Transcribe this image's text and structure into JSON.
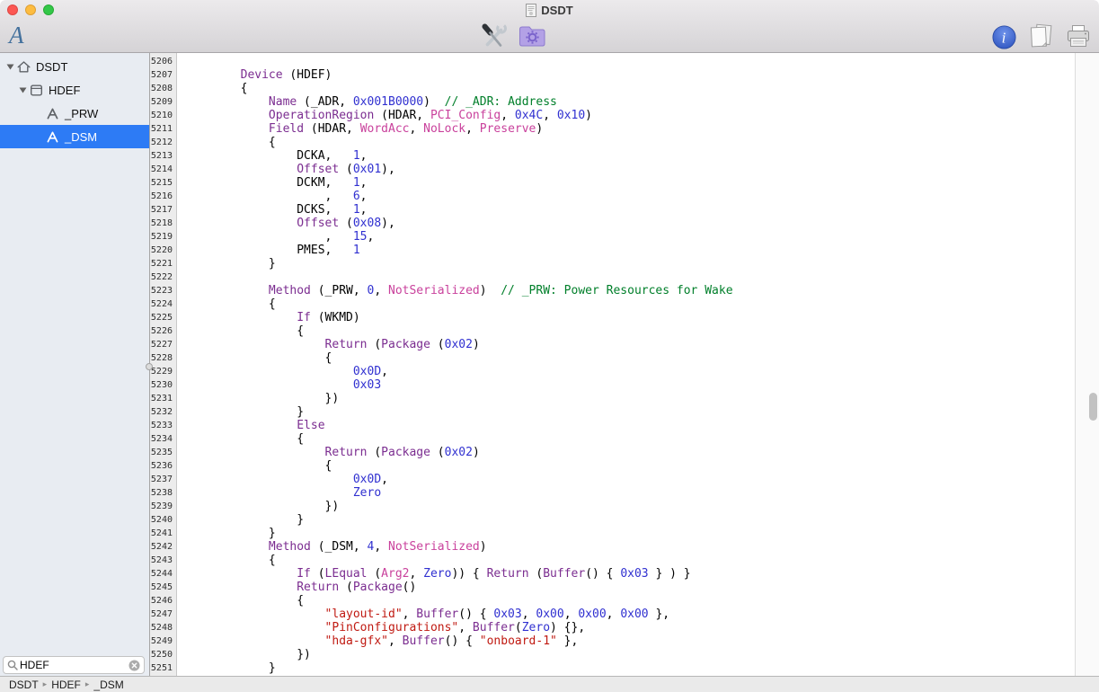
{
  "window": {
    "title": "DSDT"
  },
  "toolbar": {
    "font_button_label": "A",
    "center_items": [
      {
        "name": "compile-tools",
        "icon": "screwdriver-wrench-icon"
      },
      {
        "name": "patch",
        "icon": "folder-gear-icon"
      }
    ],
    "right_items": [
      {
        "name": "info",
        "icon": "info-icon"
      },
      {
        "name": "summary",
        "icon": "documents-icon"
      },
      {
        "name": "print",
        "icon": "printer-icon"
      }
    ]
  },
  "sidebar": {
    "items": [
      {
        "label": "DSDT",
        "icon": "house-icon",
        "level": 0,
        "expanded": true,
        "selected": false
      },
      {
        "label": "HDEF",
        "icon": "device-icon",
        "level": 1,
        "expanded": true,
        "selected": false
      },
      {
        "label": "_PRW",
        "icon": "method-icon",
        "level": 2,
        "expanded": false,
        "selected": false
      },
      {
        "label": "_DSM",
        "icon": "method-icon",
        "level": 2,
        "expanded": false,
        "selected": true
      }
    ],
    "search": {
      "value": "HDEF"
    }
  },
  "statusbar": {
    "path": [
      "DSDT",
      "HDEF",
      "_DSM"
    ],
    "separator": "▸"
  },
  "colors": {
    "selection": "#2d7bf5"
  },
  "editor": {
    "first_line": 5206,
    "last_line": 5251,
    "syntax_colors": {
      "keyword": "#7b2d90",
      "number": "#3030d0",
      "string": "#c01a12",
      "comment": "#007f2a",
      "predefined": "#c9419c",
      "plain": "#000000"
    },
    "lines": [
      {
        "n": 5206,
        "s": []
      },
      {
        "n": 5207,
        "s": [
          [
            "t",
            "        "
          ],
          [
            "k",
            "Device"
          ],
          [
            "t",
            " (HDEF)"
          ]
        ]
      },
      {
        "n": 5208,
        "s": [
          [
            "t",
            "        {"
          ]
        ]
      },
      {
        "n": 5209,
        "s": [
          [
            "t",
            "            "
          ],
          [
            "k",
            "Name"
          ],
          [
            "t",
            " (_ADR, "
          ],
          [
            "n",
            "0x001B0000"
          ],
          [
            "t",
            ")  "
          ],
          [
            "c",
            "// _ADR: Address"
          ]
        ]
      },
      {
        "n": 5210,
        "s": [
          [
            "t",
            "            "
          ],
          [
            "k",
            "OperationRegion"
          ],
          [
            "t",
            " (HDAR, "
          ],
          [
            "p",
            "PCI_Config"
          ],
          [
            "t",
            ", "
          ],
          [
            "n",
            "0x4C"
          ],
          [
            "t",
            ", "
          ],
          [
            "n",
            "0x10"
          ],
          [
            "t",
            ")"
          ]
        ]
      },
      {
        "n": 5211,
        "s": [
          [
            "t",
            "            "
          ],
          [
            "k",
            "Field"
          ],
          [
            "t",
            " (HDAR, "
          ],
          [
            "p",
            "WordAcc"
          ],
          [
            "t",
            ", "
          ],
          [
            "p",
            "NoLock"
          ],
          [
            "t",
            ", "
          ],
          [
            "p",
            "Preserve"
          ],
          [
            "t",
            ")"
          ]
        ]
      },
      {
        "n": 5212,
        "s": [
          [
            "t",
            "            {"
          ]
        ]
      },
      {
        "n": 5213,
        "s": [
          [
            "t",
            "                DCKA,   "
          ],
          [
            "n",
            "1"
          ],
          [
            "t",
            ","
          ]
        ]
      },
      {
        "n": 5214,
        "s": [
          [
            "t",
            "                "
          ],
          [
            "k",
            "Offset"
          ],
          [
            "t",
            " ("
          ],
          [
            "n",
            "0x01"
          ],
          [
            "t",
            "),"
          ]
        ]
      },
      {
        "n": 5215,
        "s": [
          [
            "t",
            "                DCKM,   "
          ],
          [
            "n",
            "1"
          ],
          [
            "t",
            ","
          ]
        ]
      },
      {
        "n": 5216,
        "s": [
          [
            "t",
            "                    ,   "
          ],
          [
            "n",
            "6"
          ],
          [
            "t",
            ","
          ]
        ]
      },
      {
        "n": 5217,
        "s": [
          [
            "t",
            "                DCKS,   "
          ],
          [
            "n",
            "1"
          ],
          [
            "t",
            ","
          ]
        ]
      },
      {
        "n": 5218,
        "s": [
          [
            "t",
            "                "
          ],
          [
            "k",
            "Offset"
          ],
          [
            "t",
            " ("
          ],
          [
            "n",
            "0x08"
          ],
          [
            "t",
            "),"
          ]
        ]
      },
      {
        "n": 5219,
        "s": [
          [
            "t",
            "                    ,   "
          ],
          [
            "n",
            "15"
          ],
          [
            "t",
            ","
          ]
        ]
      },
      {
        "n": 5220,
        "s": [
          [
            "t",
            "                PMES,   "
          ],
          [
            "n",
            "1"
          ]
        ]
      },
      {
        "n": 5221,
        "s": [
          [
            "t",
            "            }"
          ]
        ]
      },
      {
        "n": 5222,
        "s": []
      },
      {
        "n": 5223,
        "s": [
          [
            "t",
            "            "
          ],
          [
            "k",
            "Method"
          ],
          [
            "t",
            " (_PRW, "
          ],
          [
            "n",
            "0"
          ],
          [
            "t",
            ", "
          ],
          [
            "p",
            "NotSerialized"
          ],
          [
            "t",
            ")  "
          ],
          [
            "c",
            "// _PRW: Power Resources for Wake"
          ]
        ]
      },
      {
        "n": 5224,
        "s": [
          [
            "t",
            "            {"
          ]
        ]
      },
      {
        "n": 5225,
        "s": [
          [
            "t",
            "                "
          ],
          [
            "k",
            "If"
          ],
          [
            "t",
            " (WKMD)"
          ]
        ]
      },
      {
        "n": 5226,
        "s": [
          [
            "t",
            "                {"
          ]
        ]
      },
      {
        "n": 5227,
        "s": [
          [
            "t",
            "                    "
          ],
          [
            "k",
            "Return"
          ],
          [
            "t",
            " ("
          ],
          [
            "k",
            "Package"
          ],
          [
            "t",
            " ("
          ],
          [
            "n",
            "0x02"
          ],
          [
            "t",
            ")"
          ]
        ]
      },
      {
        "n": 5228,
        "s": [
          [
            "t",
            "                    {"
          ]
        ]
      },
      {
        "n": 5229,
        "s": [
          [
            "t",
            "                        "
          ],
          [
            "n",
            "0x0D"
          ],
          [
            "t",
            ","
          ]
        ]
      },
      {
        "n": 5230,
        "s": [
          [
            "t",
            "                        "
          ],
          [
            "n",
            "0x03"
          ]
        ]
      },
      {
        "n": 5231,
        "s": [
          [
            "t",
            "                    })"
          ]
        ]
      },
      {
        "n": 5232,
        "s": [
          [
            "t",
            "                }"
          ]
        ]
      },
      {
        "n": 5233,
        "s": [
          [
            "t",
            "                "
          ],
          [
            "k",
            "Else"
          ]
        ]
      },
      {
        "n": 5234,
        "s": [
          [
            "t",
            "                {"
          ]
        ]
      },
      {
        "n": 5235,
        "s": [
          [
            "t",
            "                    "
          ],
          [
            "k",
            "Return"
          ],
          [
            "t",
            " ("
          ],
          [
            "k",
            "Package"
          ],
          [
            "t",
            " ("
          ],
          [
            "n",
            "0x02"
          ],
          [
            "t",
            ")"
          ]
        ]
      },
      {
        "n": 5236,
        "s": [
          [
            "t",
            "                    {"
          ]
        ]
      },
      {
        "n": 5237,
        "s": [
          [
            "t",
            "                        "
          ],
          [
            "n",
            "0x0D"
          ],
          [
            "t",
            ","
          ]
        ]
      },
      {
        "n": 5238,
        "s": [
          [
            "t",
            "                        "
          ],
          [
            "n",
            "Zero"
          ]
        ]
      },
      {
        "n": 5239,
        "s": [
          [
            "t",
            "                    })"
          ]
        ]
      },
      {
        "n": 5240,
        "s": [
          [
            "t",
            "                }"
          ]
        ]
      },
      {
        "n": 5241,
        "s": [
          [
            "t",
            "            }"
          ]
        ]
      },
      {
        "n": 5242,
        "s": [
          [
            "t",
            "            "
          ],
          [
            "k",
            "Method"
          ],
          [
            "t",
            " (_DSM, "
          ],
          [
            "n",
            "4"
          ],
          [
            "t",
            ", "
          ],
          [
            "p",
            "NotSerialized"
          ],
          [
            "t",
            ")"
          ]
        ]
      },
      {
        "n": 5243,
        "s": [
          [
            "t",
            "            {"
          ]
        ]
      },
      {
        "n": 5244,
        "s": [
          [
            "t",
            "                "
          ],
          [
            "k",
            "If"
          ],
          [
            "t",
            " ("
          ],
          [
            "k",
            "LEqual"
          ],
          [
            "t",
            " ("
          ],
          [
            "p",
            "Arg2"
          ],
          [
            "t",
            ", "
          ],
          [
            "n",
            "Zero"
          ],
          [
            "t",
            ")) { "
          ],
          [
            "k",
            "Return"
          ],
          [
            "t",
            " ("
          ],
          [
            "k",
            "Buffer"
          ],
          [
            "t",
            "() { "
          ],
          [
            "n",
            "0x03"
          ],
          [
            "t",
            " } ) }"
          ]
        ]
      },
      {
        "n": 5245,
        "s": [
          [
            "t",
            "                "
          ],
          [
            "k",
            "Return"
          ],
          [
            "t",
            " ("
          ],
          [
            "k",
            "Package"
          ],
          [
            "t",
            "()"
          ]
        ]
      },
      {
        "n": 5246,
        "s": [
          [
            "t",
            "                {"
          ]
        ]
      },
      {
        "n": 5247,
        "s": [
          [
            "t",
            "                    "
          ],
          [
            "s",
            "\"layout-id\""
          ],
          [
            "t",
            ", "
          ],
          [
            "k",
            "Buffer"
          ],
          [
            "t",
            "() { "
          ],
          [
            "n",
            "0x03"
          ],
          [
            "t",
            ", "
          ],
          [
            "n",
            "0x00"
          ],
          [
            "t",
            ", "
          ],
          [
            "n",
            "0x00"
          ],
          [
            "t",
            ", "
          ],
          [
            "n",
            "0x00"
          ],
          [
            "t",
            " },"
          ]
        ]
      },
      {
        "n": 5248,
        "s": [
          [
            "t",
            "                    "
          ],
          [
            "s",
            "\"PinConfigurations\""
          ],
          [
            "t",
            ", "
          ],
          [
            "k",
            "Buffer"
          ],
          [
            "t",
            "("
          ],
          [
            "n",
            "Zero"
          ],
          [
            "t",
            ") {},"
          ]
        ]
      },
      {
        "n": 5249,
        "s": [
          [
            "t",
            "                    "
          ],
          [
            "s",
            "\"hda-gfx\""
          ],
          [
            "t",
            ", "
          ],
          [
            "k",
            "Buffer"
          ],
          [
            "t",
            "() { "
          ],
          [
            "s",
            "\"onboard-1\""
          ],
          [
            "t",
            " },"
          ]
        ]
      },
      {
        "n": 5250,
        "s": [
          [
            "t",
            "                })"
          ]
        ]
      },
      {
        "n": 5251,
        "s": [
          [
            "t",
            "            }"
          ]
        ]
      }
    ]
  }
}
